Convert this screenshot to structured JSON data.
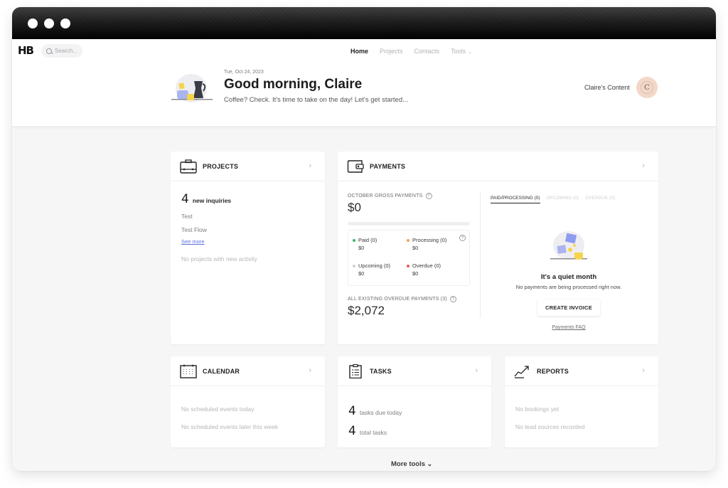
{
  "window": {
    "controls": [
      "close",
      "minimize",
      "maximize"
    ]
  },
  "topnav": {
    "logo": "HB",
    "search_placeholder": "Search...",
    "links": [
      {
        "label": "Home",
        "active": true
      },
      {
        "label": "Projects",
        "active": false
      },
      {
        "label": "Contacts",
        "active": false
      },
      {
        "label": "Tools",
        "active": false,
        "has_dropdown": true
      }
    ]
  },
  "hero": {
    "date": "Tue, Oct 24, 2023",
    "greeting": "Good morning, Claire",
    "subline": "Coffee? Check. It's time to take on the day! Let's get started...",
    "company_name": "Claire's Content",
    "avatar_initial": "C",
    "avatar_color": "#f2d8c8"
  },
  "projects": {
    "title": "PROJECTS",
    "new_inquiries_count": "4",
    "new_inquiries_label": "new inquiries",
    "items": [
      "Test",
      "Test Flow"
    ],
    "see_more": "See more",
    "activity_empty": "No projects with new activity"
  },
  "payments": {
    "title": "PAYMENTS",
    "gross_label": "OCTOBER GROSS PAYMENTS",
    "gross_amount": "$0",
    "statuses": [
      {
        "label": "Paid (0)",
        "amount": "$0",
        "color": "#3cb46a"
      },
      {
        "label": "Processing (0)",
        "amount": "$0",
        "color": "#f4a261"
      },
      {
        "label": "Upcoming (0)",
        "amount": "$0",
        "color": "#cfcfd6"
      },
      {
        "label": "Overdue (0)",
        "amount": "$0",
        "color": "#e85a4f"
      }
    ],
    "overdue_label": "ALL EXISTING OVERDUE PAYMENTS (3)",
    "overdue_amount": "$2,072",
    "tabs": [
      {
        "label": "PAID/PROCESSING (0)",
        "active": true
      },
      {
        "label": "UPCOMING (0)",
        "active": false
      },
      {
        "label": "OVERDUE (3)",
        "active": false
      }
    ],
    "empty_title": "It's a quiet month",
    "empty_sub": "No payments are being processed right now.",
    "create_invoice": "CREATE INVOICE",
    "faq_link": "Payments FAQ"
  },
  "calendar": {
    "title": "CALENDAR",
    "lines": [
      "No scheduled events today",
      "No scheduled events later this week"
    ]
  },
  "tasks": {
    "title": "TASKS",
    "lines": [
      {
        "count": "4",
        "label": "tasks due today"
      },
      {
        "count": "4",
        "label": "total tasks"
      }
    ]
  },
  "reports": {
    "title": "REPORTS",
    "lines": [
      "No bookings yet",
      "No lead sources recorded"
    ]
  },
  "footer": {
    "more_tools": "More tools"
  }
}
